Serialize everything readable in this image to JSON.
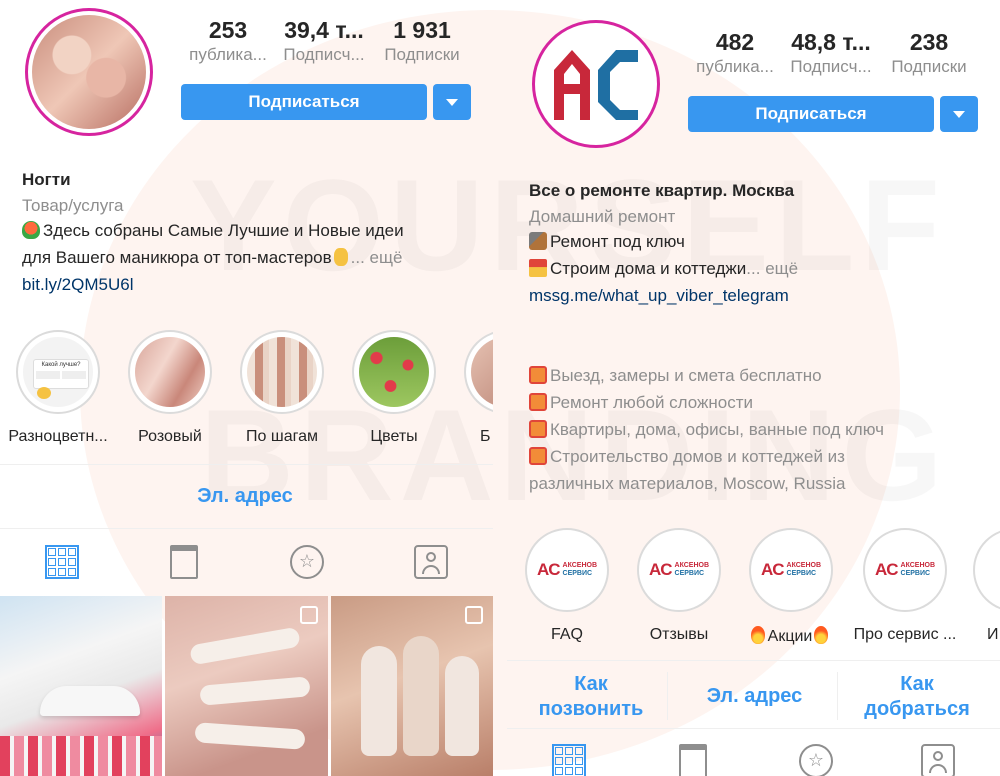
{
  "left": {
    "stats": [
      {
        "value": "253",
        "label": "публика..."
      },
      {
        "value": "39,4 т...",
        "label": "Подписч..."
      },
      {
        "value": "1 931",
        "label": "Подписки"
      }
    ],
    "follow_label": "Подписаться",
    "name": "Ногти",
    "category": "Товар/услуга",
    "bio_line1": "Здесь собраны Самые Лучшие и Новые идеи",
    "bio_line2": "для Вашего маникюра от топ-мастеров",
    "bio_more": "... ещё",
    "link": "bit.ly/2QM5U6l",
    "highlights": [
      {
        "label": "Разноцветн...",
        "card_text": "Какой лучше?"
      },
      {
        "label": "Розовый"
      },
      {
        "label": "По шагам"
      },
      {
        "label": "Цветы"
      },
      {
        "label": "Б"
      }
    ],
    "contact_email": "Эл. адрес"
  },
  "right": {
    "stats": [
      {
        "value": "482",
        "label": "публика..."
      },
      {
        "value": "48,8 т...",
        "label": "Подписч..."
      },
      {
        "value": "238",
        "label": "Подписки"
      }
    ],
    "follow_label": "Подписаться",
    "avatar_letters": "AC",
    "name": "Все о ремонте квартир. Москва",
    "category": "Домашний ремонт",
    "bio_line1": "Ремонт под ключ",
    "bio_line2": "Строим дома и коттеджи",
    "bio_more": "... ещё",
    "link": "mssg.me/what_up_viber_telegram",
    "bio_extra": [
      "Выезд, замеры и смета бесплатно",
      "Ремонт любой сложности",
      "Квартиры, дома, офисы, ванные под ключ",
      "Строительство домов и коттеджей из"
    ],
    "bio_extra_cont": "различных материалов, Moscow, Russia",
    "highlights": [
      {
        "label": "FAQ"
      },
      {
        "label": "Отзывы"
      },
      {
        "label": "Акции"
      },
      {
        "label": "Про сервис ..."
      },
      {
        "label": "И"
      }
    ],
    "highlight_logo": {
      "letters": "AC",
      "line1": "АКСЕНОВ",
      "line2": "СЕРВИС"
    },
    "contacts": {
      "call": "Как позвонить",
      "email": "Эл. адрес",
      "route": "Как добраться"
    }
  },
  "watermark": {
    "line1": "YOURSELF",
    "line2": "BRANDING"
  },
  "colors": {
    "accent": "#3897f0",
    "muted": "#8e8e8e",
    "text": "#262626",
    "link": "#003569",
    "brand_red": "#c8283a",
    "brand_blue": "#1f6fa3"
  }
}
